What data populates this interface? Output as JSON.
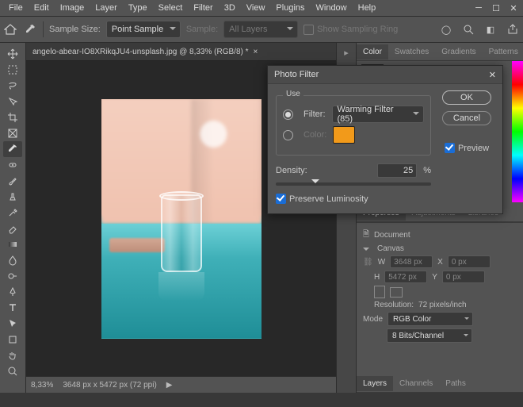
{
  "menu": {
    "items": [
      "File",
      "Edit",
      "Image",
      "Layer",
      "Type",
      "Select",
      "Filter",
      "3D",
      "View",
      "Plugins",
      "Window",
      "Help"
    ]
  },
  "options_bar": {
    "sample_size_label": "Sample Size:",
    "sample_size_value": "Point Sample",
    "sample_label": "Sample:",
    "sample_value": "All Layers",
    "show_ring": "Show Sampling Ring"
  },
  "document": {
    "tab_title": "angelo-abear-IO8XRikqJU4-unsplash.jpg @ 8,33% (RGB/8) *"
  },
  "status": {
    "zoom": "8,33%",
    "info": "3648 px x 5472 px (72 ppi)"
  },
  "right": {
    "color_tabs": [
      "Color",
      "Swatches",
      "Gradients",
      "Patterns"
    ],
    "props_tabs": [
      "Properties",
      "Adjustments",
      "Libraries"
    ],
    "doc_label": "Document",
    "canvas_label": "Canvas",
    "w": "3648 px",
    "h": "5472 px",
    "x": "0 px",
    "y": "0 px",
    "w_label": "W",
    "h_label": "H",
    "x_label": "X",
    "y_label": "Y",
    "res_label": "Resolution:",
    "res_value": "72 pixels/inch",
    "mode_label": "Mode",
    "mode_value": "RGB Color",
    "bits_value": "8 Bits/Channel",
    "layer_tabs": [
      "Layers",
      "Channels",
      "Paths"
    ]
  },
  "dialog": {
    "title": "Photo Filter",
    "use": "Use",
    "filter_label": "Filter:",
    "filter_value": "Warming Filter (85)",
    "color_label": "Color:",
    "color_hex": "#f29a1a",
    "density_label": "Density:",
    "density_value": "25",
    "density_unit": "%",
    "preserve": "Preserve Luminosity",
    "ok": "OK",
    "cancel": "Cancel",
    "preview": "Preview"
  }
}
